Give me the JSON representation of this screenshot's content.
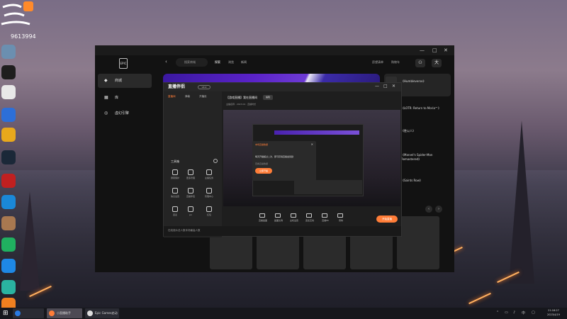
{
  "desktop": {
    "badge_number": "9613994",
    "icons": [
      {
        "label": "",
        "color": "#6b8fb0"
      },
      {
        "label": "",
        "color": "#1e1e1e"
      },
      {
        "label": "",
        "color": "#e8e8e8"
      },
      {
        "label": "",
        "color": "#2d6fd8"
      },
      {
        "label": "",
        "color": "#e8a81c"
      },
      {
        "label": "",
        "color": "#1b2838"
      },
      {
        "label": "",
        "color": "#c02020"
      },
      {
        "label": "",
        "color": "#1a88d8"
      },
      {
        "label": "",
        "color": "#a87850"
      },
      {
        "label": "",
        "color": "#20b060"
      },
      {
        "label": "",
        "color": "#1e88e5"
      },
      {
        "label": "",
        "color": "#2ab3a0"
      },
      {
        "label": "",
        "color": "#f08020"
      }
    ]
  },
  "epic": {
    "logo_text": "EPIC",
    "sidebar": [
      {
        "label": "商城"
      },
      {
        "label": "库"
      },
      {
        "label": "虚幻引擎"
      }
    ],
    "search_placeholder": "搜索商城",
    "nav": [
      "探索",
      "浏览",
      "新闻"
    ],
    "right_nav": [
      "愿望清单",
      "购物车"
    ],
    "user_initial": "大",
    "games": [
      {
        "name": "《Humbleverse》"
      },
      {
        "name": "《LOTR: Return to Moria™》"
      },
      {
        "name": "《胜以人》"
      },
      {
        "name": "《Marvel's Spider-Man Remastered》"
      },
      {
        "name": "《Saints Row》"
      }
    ]
  },
  "stream_app": {
    "logo": "直播伴侣",
    "tag": "V2.0",
    "tabs": [
      "直播间",
      "弹幕",
      "开播设"
    ],
    "tools_title": "工具箱",
    "tools": [
      {
        "label": "屏幕保护"
      },
      {
        "label": "更多管理"
      },
      {
        "label": "主播任务"
      },
      {
        "label": "信息设置"
      },
      {
        "label": "直播伴侣"
      },
      {
        "label": "管理中心"
      },
      {
        "label": "连麦"
      },
      {
        "label": "pk"
      },
      {
        "label": "红包"
      }
    ],
    "bottom_text": "在线观众总人数本场最高人数",
    "stream_title": "【游戏直播】我在直播间",
    "title_badge": "编辑",
    "meta": "主播名称 · 2023.04 · 直播时长",
    "controls": [
      {
        "label": "直播画面"
      },
      {
        "label": "画面比例"
      },
      {
        "label": "主机设置"
      },
      {
        "label": "连麦互动"
      },
      {
        "label": "直播PK"
      },
      {
        "label": "音效"
      }
    ],
    "live_button": "开始直播"
  },
  "dialog": {
    "title": "本场直播数据",
    "body": "每天开播超过二次，即可获得直播金奖励",
    "link": "查看直播数据",
    "button": "立即开播"
  },
  "taskbar": {
    "buttons": [
      {
        "label": "",
        "color": "#2a7ae2"
      },
      {
        "label": "小直播助手",
        "color": "#ff7d38"
      },
      {
        "label": "Epic Games启动",
        "color": "#dddddd"
      }
    ],
    "time": "21:18:27",
    "date": "2023/4/19"
  }
}
